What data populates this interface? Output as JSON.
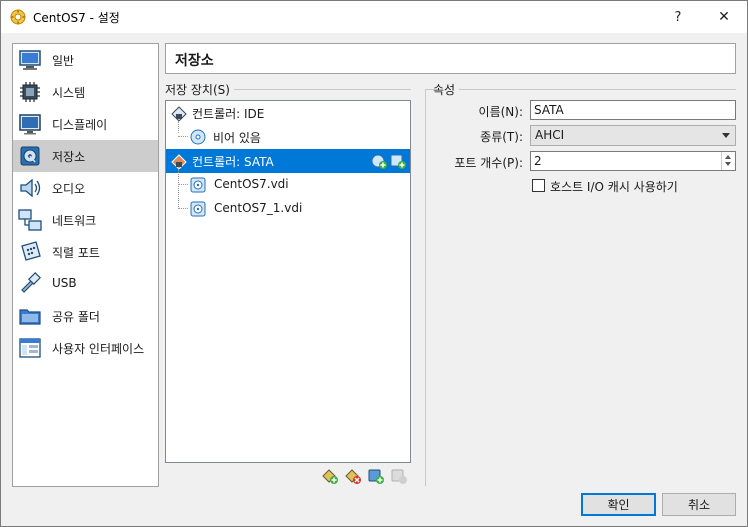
{
  "window": {
    "title": "CentOS7 - 설정",
    "help_label": "?",
    "close_label": "✕"
  },
  "sidebar": {
    "items": [
      {
        "label": "일반",
        "icon": "general-icon",
        "active": false
      },
      {
        "label": "시스템",
        "icon": "system-icon",
        "active": false
      },
      {
        "label": "디스플레이",
        "icon": "display-icon",
        "active": false
      },
      {
        "label": "저장소",
        "icon": "storage-icon",
        "active": true
      },
      {
        "label": "오디오",
        "icon": "audio-icon",
        "active": false
      },
      {
        "label": "네트워크",
        "icon": "network-icon",
        "active": false
      },
      {
        "label": "직렬 포트",
        "icon": "serial-port-icon",
        "active": false
      },
      {
        "label": "USB",
        "icon": "usb-icon",
        "active": false
      },
      {
        "label": "공유 폴더",
        "icon": "shared-folder-icon",
        "active": false
      },
      {
        "label": "사용자 인터페이스",
        "icon": "user-interface-icon",
        "active": false
      }
    ]
  },
  "header": {
    "title": "저장소"
  },
  "storage": {
    "group_label": "저장 장치(S)",
    "tree": [
      {
        "label": "컨트롤러: IDE",
        "type": "controller",
        "level": 0,
        "selected": false
      },
      {
        "label": "비어 있음",
        "type": "optical",
        "level": 1,
        "selected": false
      },
      {
        "label": "컨트롤러: SATA",
        "type": "controller",
        "level": 0,
        "selected": true
      },
      {
        "label": "CentOS7.vdi",
        "type": "disk",
        "level": 1,
        "selected": false
      },
      {
        "label": "CentOS7_1.vdi",
        "type": "disk",
        "level": 1,
        "selected": false
      }
    ]
  },
  "attributes": {
    "group_label": "속성",
    "name_label": "이름(N):",
    "name_value": "SATA",
    "type_label": "종류(T):",
    "type_value": "AHCI",
    "port_label": "포트 개수(P):",
    "port_value": "2",
    "host_io_cache_label": "호스트 I/O 캐시 사용하기",
    "host_io_cache_checked": false
  },
  "buttons": {
    "ok": "확인",
    "cancel": "취소"
  },
  "colors": {
    "selection": "#0078d7",
    "active_sidebar": "#cdcdcd"
  }
}
